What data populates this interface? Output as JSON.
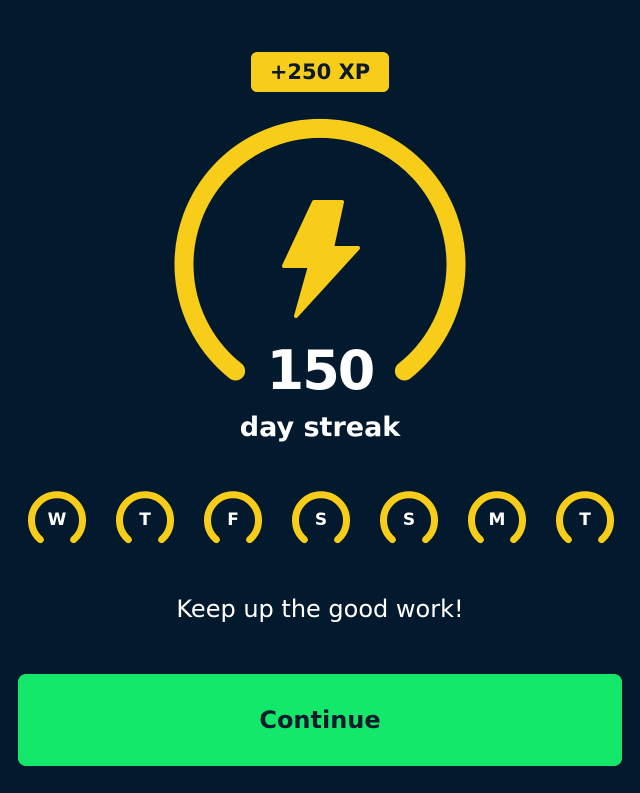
{
  "xp_badge": {
    "label": "+250 XP"
  },
  "streak": {
    "count": "150",
    "label": "day streak",
    "icon": "lightning-bolt-icon"
  },
  "week": {
    "days": [
      {
        "label": "W"
      },
      {
        "label": "T"
      },
      {
        "label": "F"
      },
      {
        "label": "S"
      },
      {
        "label": "S"
      },
      {
        "label": "M"
      },
      {
        "label": "T"
      }
    ]
  },
  "message": "Keep up the good work!",
  "continue_button": {
    "label": "Continue"
  },
  "colors": {
    "background": "#031a2e",
    "accent_yellow": "#f8cd1a",
    "button_green": "#14e86b",
    "text_white": "#ffffff"
  }
}
